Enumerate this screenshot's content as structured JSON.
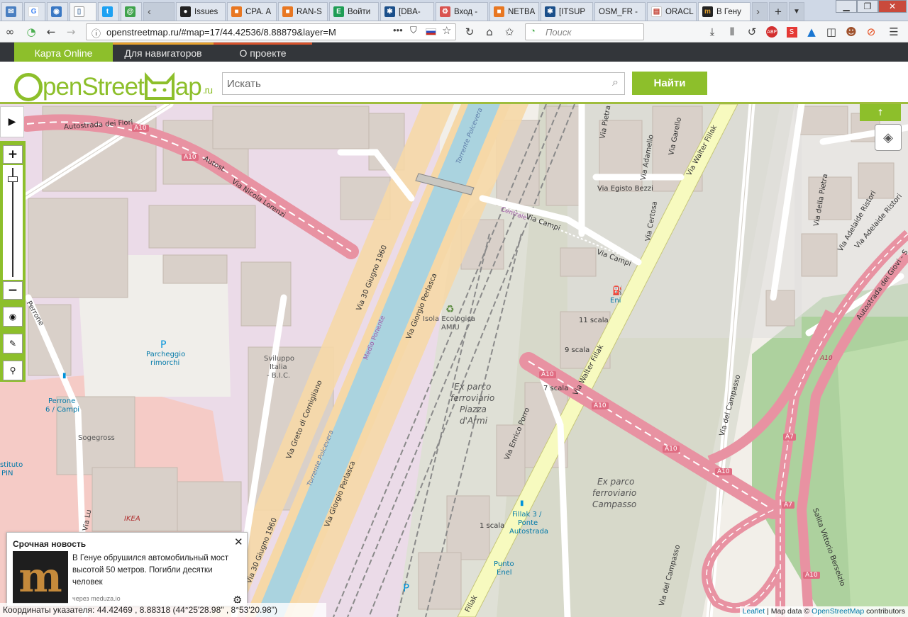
{
  "browser": {
    "tabs": [
      {
        "label": "",
        "color": "#4a7fc1",
        "icon": "mail-icon"
      },
      {
        "label": "",
        "color": "#4285f4",
        "icon": "google-icon"
      },
      {
        "label": "",
        "color": "#3a78c4",
        "icon": "wifi-icon"
      },
      {
        "label": "",
        "color": "#5b7fa8",
        "icon": "page-icon"
      },
      {
        "label": "",
        "color": "#1da1f2",
        "icon": "twitter-icon"
      },
      {
        "label": "",
        "color": "#3fa34d",
        "icon": "spiral-icon"
      },
      {
        "label": "Issues",
        "color": "#222",
        "icon": "github-icon"
      },
      {
        "label": "CPA. A",
        "color": "#e87722",
        "icon": "orange-icon"
      },
      {
        "label": "RAN-S",
        "color": "#e87722",
        "icon": "orange-icon"
      },
      {
        "label": "Войти",
        "color": "#1f9d55",
        "icon": "excel-icon"
      },
      {
        "label": "[DBA-",
        "color": "#1b4f8a",
        "icon": "jira-icon"
      },
      {
        "label": "Вход -",
        "color": "#d9534f",
        "icon": "gear-red-icon"
      },
      {
        "label": "NETBA",
        "color": "#e87722",
        "icon": "orange-icon"
      },
      {
        "label": "[ITSUP",
        "color": "#1b4f8a",
        "icon": "jira-icon"
      },
      {
        "label": "OSM_FR -",
        "color": "#ccc",
        "icon": "blank-icon"
      },
      {
        "label": "ORACL",
        "color": "#c0392b",
        "icon": "oracle-icon"
      },
      {
        "label": "В Гену",
        "color": "#222",
        "icon": "meduza-icon"
      }
    ],
    "url": "openstreetmap.ru/#map=17/44.42536/8.88879&layer=M",
    "search_placeholder": "Поиск"
  },
  "osm": {
    "nav_tabs": [
      "Карта Online",
      "Для навигаторов",
      "О проекте"
    ],
    "logo": {
      "part1": "O",
      "part2": "penStreet",
      "part3": "ap",
      "suffix": ".ru"
    },
    "search_placeholder": "Искать",
    "search_button": "Найти"
  },
  "map": {
    "labels": {
      "autostrada_fiori": "Autostrada dei Fiori",
      "autost": "Autost.",
      "a10": "A10",
      "a7": "A7",
      "via_nicola_lorenzi": "Via Nicola Lorenzi",
      "via_30_giugno_1960": "Via 30 Giugno 1960",
      "via_giorgio_perlasca": "Via Giorgio Perlasca",
      "medio_ponente": "Medio Ponente",
      "torrente_polcevera": "Torrente Polcevera",
      "via_greto": "Via Greto di Cornigliano",
      "isola": "Isola Ecologica",
      "amiu": "AMIU",
      "ex_parco1_l1": "Ex parco",
      "ex_parco1_l2": "ferroviario",
      "ex_parco1_l3": "Piazza",
      "ex_parco1_l4": "d'Armi",
      "ex_parco2_l1": "Ex parco",
      "ex_parco2_l2": "ferroviario",
      "ex_parco2_l3": "Campasso",
      "parcheggio_l1": "Parcheggio",
      "parcheggio_l2": "rimorchi",
      "sviluppo_l1": "Sviluppo",
      "sviluppo_l2": "Italia",
      "sviluppo_l3": "- B.I.C.",
      "sogegross": "Sogegross",
      "ikea": "IKEA",
      "perrone_l1": "Perrone",
      "perrone_l2": "6 / Campi",
      "perrone_road": "Perrone",
      "via_campi": "Via Campi",
      "centrale": "Centrale",
      "via_walter_fillak": "Via Walter Fillak",
      "via_egisto_bezzi": "Via Egisto Bezzi",
      "via_certosa": "Via Certosa",
      "via_adamello": "Via Adamello",
      "via_garello": "Via Garello",
      "via_pietra": "Via Pietra",
      "via_della_pietra": "Via della Pietra",
      "via_adelaide_ristori": "Via Adelaide Ristori",
      "autostrada_giovi": "Autostrada dei Giovi - S",
      "via_del_campasso": "Via del Campasso",
      "salita_berselzio": "Salita Vittorio Berselzio",
      "via_enrico_porro": "Via Enrico Porro",
      "fillak_l1": "Fillak 3 /",
      "fillak_l2": "Ponte",
      "fillak_l3": "Autostrada",
      "punto_l1": "Punto",
      "punto_l2": "Enel",
      "eni": "Eni",
      "scala_11": "11 scala",
      "scala_9": "9 scala",
      "scala_7": "7 scala",
      "scala_1": "1 scala",
      "via_lu": "Via Lu",
      "istituto": "stituto",
      "pin": "PIN",
      "fillak_short": "Fillak",
      "p": "P"
    },
    "attribution": {
      "leaflet": "Leaflet",
      "sep": " | Map data © ",
      "osm": "OpenStreetMap",
      "contrib": " contributors"
    },
    "coordinates": "Координаты указателя:  44.42469 , 8.88318 (44°25'28.98\" , 8°53'20.98\")"
  },
  "news": {
    "header": "Срочная новость",
    "text": "В Генуе обрушился автомобильный мост высотой 50 метров. Погибли десятки человек",
    "via": "через meduza.io",
    "logo": "m"
  }
}
